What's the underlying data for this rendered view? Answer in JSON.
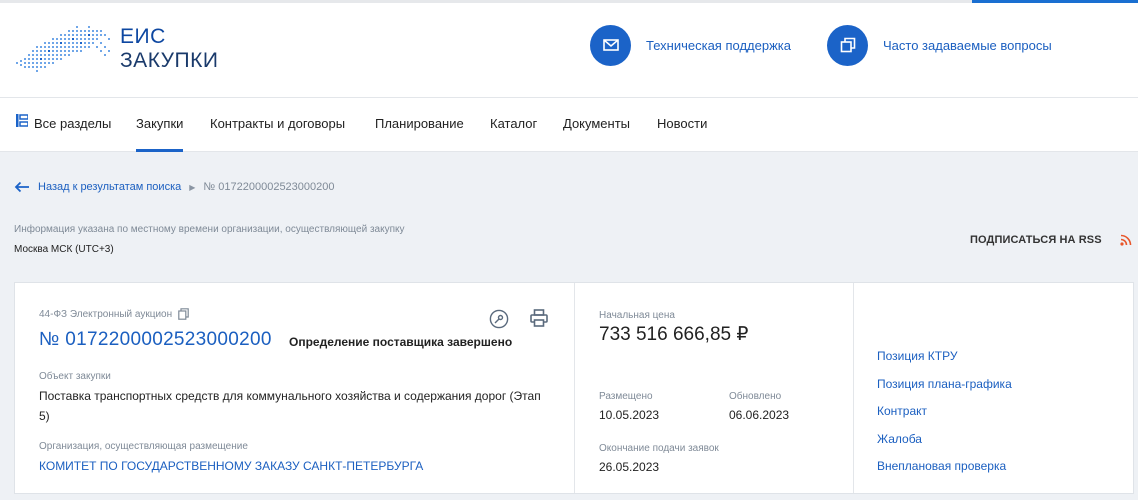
{
  "header": {
    "logo_line1": "ЕИС",
    "logo_line2": "ЗАКУПКИ",
    "support_label": "Техническая поддержка",
    "faq_label": "Часто задаваемые вопросы"
  },
  "nav": {
    "items": [
      {
        "label": "Все разделы"
      },
      {
        "label": "Закупки"
      },
      {
        "label": "Контракты и договоры"
      },
      {
        "label": "Планирование"
      },
      {
        "label": "Каталог"
      },
      {
        "label": "Документы"
      },
      {
        "label": "Новости"
      }
    ],
    "active_index": 1
  },
  "breadcrumb": {
    "back_label": "Назад к результатам поиска",
    "current": "№ 0172200002523000200"
  },
  "timezone": {
    "note": "Информация указана по местному времени организации, осуществляющей закупку",
    "value": "Москва МСК (UTC+3)"
  },
  "rss_label": "ПОДПИСАТЬСЯ НА RSS",
  "purchase": {
    "law": "44-ФЗ Электронный аукцион",
    "number": "№ 0172200002523000200",
    "status": "Определение поставщика завершено",
    "object_label": "Объект закупки",
    "object_value": "Поставка транспортных средств для коммунального хозяйства и содержания дорог (Этап 5)",
    "org_label": "Организация, осуществляющая размещение",
    "org_value": "КОМИТЕТ ПО ГОСУДАРСТВЕННОМУ ЗАКАЗУ САНКТ-ПЕТЕРБУРГА",
    "price_label": "Начальная цена",
    "price_value": "733 516 666,85 ₽",
    "published_label": "Размещено",
    "published_value": "10.05.2023",
    "updated_label": "Обновлено",
    "updated_value": "06.06.2023",
    "deadline_label": "Окончание подачи заявок",
    "deadline_value": "26.05.2023"
  },
  "related_links": [
    "Позиция КТРУ",
    "Позиция плана-графика",
    "Контракт",
    "Жалоба",
    "Внеплановая проверка"
  ],
  "colors": {
    "accent": "#1b63c8",
    "link": "#1b5fc0",
    "rss": "#e8562a",
    "background": "#eef1f5"
  },
  "icons": {
    "support": "mail-icon",
    "faq": "copy-icon",
    "all_sections": "sections-icon",
    "back": "arrow-left-icon",
    "law_copy": "copy-icon",
    "key": "key-icon",
    "print": "printer-icon",
    "rss": "rss-icon"
  }
}
